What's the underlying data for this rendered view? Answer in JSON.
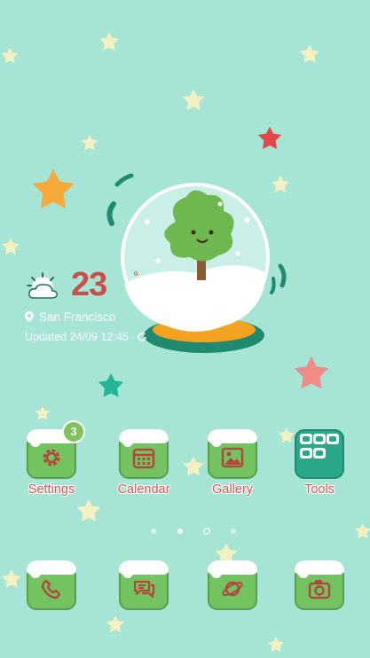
{
  "weather": {
    "temperature": "23",
    "degree_symbol": "°",
    "location": "San Francisco",
    "updated": "Updated 24/09 12:45",
    "condition_icon": "partly-sunny-icon"
  },
  "apps_row1": [
    {
      "label": "Settings",
      "icon": "gear-icon",
      "badge": "3"
    },
    {
      "label": "Calendar",
      "icon": "calendar-icon"
    },
    {
      "label": "Gallery",
      "icon": "picture-icon"
    },
    {
      "label": "Tools",
      "icon": "folder-grid-icon"
    }
  ],
  "dock": [
    {
      "icon": "phone-icon"
    },
    {
      "icon": "message-icon"
    },
    {
      "icon": "browser-planet-icon"
    },
    {
      "icon": "camera-icon"
    }
  ],
  "page_indicator": {
    "pages": 4,
    "current": 2
  },
  "colors": {
    "background": "#a6e4d6",
    "tile_green": "#74c361",
    "label_red": "#d9564f",
    "tools_teal": "#2aa889"
  }
}
